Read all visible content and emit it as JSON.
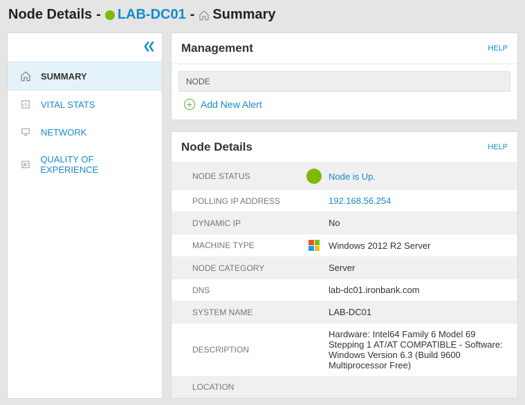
{
  "header": {
    "prefix": "Node Details",
    "sep": "-",
    "node_name": "LAB-DC01",
    "page": "Summary"
  },
  "sidebar": {
    "items": [
      {
        "label": "SUMMARY"
      },
      {
        "label": "VITAL STATS"
      },
      {
        "label": "NETWORK"
      },
      {
        "label": "QUALITY OF EXPERIENCE"
      }
    ]
  },
  "panel_management": {
    "title": "Management",
    "help": "HELP",
    "subhead": "NODE",
    "add_alert": "Add New Alert"
  },
  "panel_details": {
    "title": "Node Details",
    "help": "HELP",
    "rows": {
      "status_label": "NODE STATUS",
      "status_value": "Node is Up.",
      "ip_label": "POLLING IP ADDRESS",
      "ip_value": "192.168.56.254",
      "dynip_label": "DYNAMIC IP",
      "dynip_value": "No",
      "machine_label": "MACHINE TYPE",
      "machine_value": "Windows 2012 R2 Server",
      "cat_label": "NODE CATEGORY",
      "cat_value": "Server",
      "dns_label": "DNS",
      "dns_value": "lab-dc01.ironbank.com",
      "sys_label": "SYSTEM NAME",
      "sys_value": "LAB-DC01",
      "desc_label": "DESCRIPTION",
      "desc_value": "Hardware: Intel64 Family 6 Model 69 Stepping 1 AT/AT COMPATIBLE - Software: Windows Version 6.3 (Build 9600 Multiprocessor Free)",
      "loc_label": "LOCATION"
    }
  }
}
